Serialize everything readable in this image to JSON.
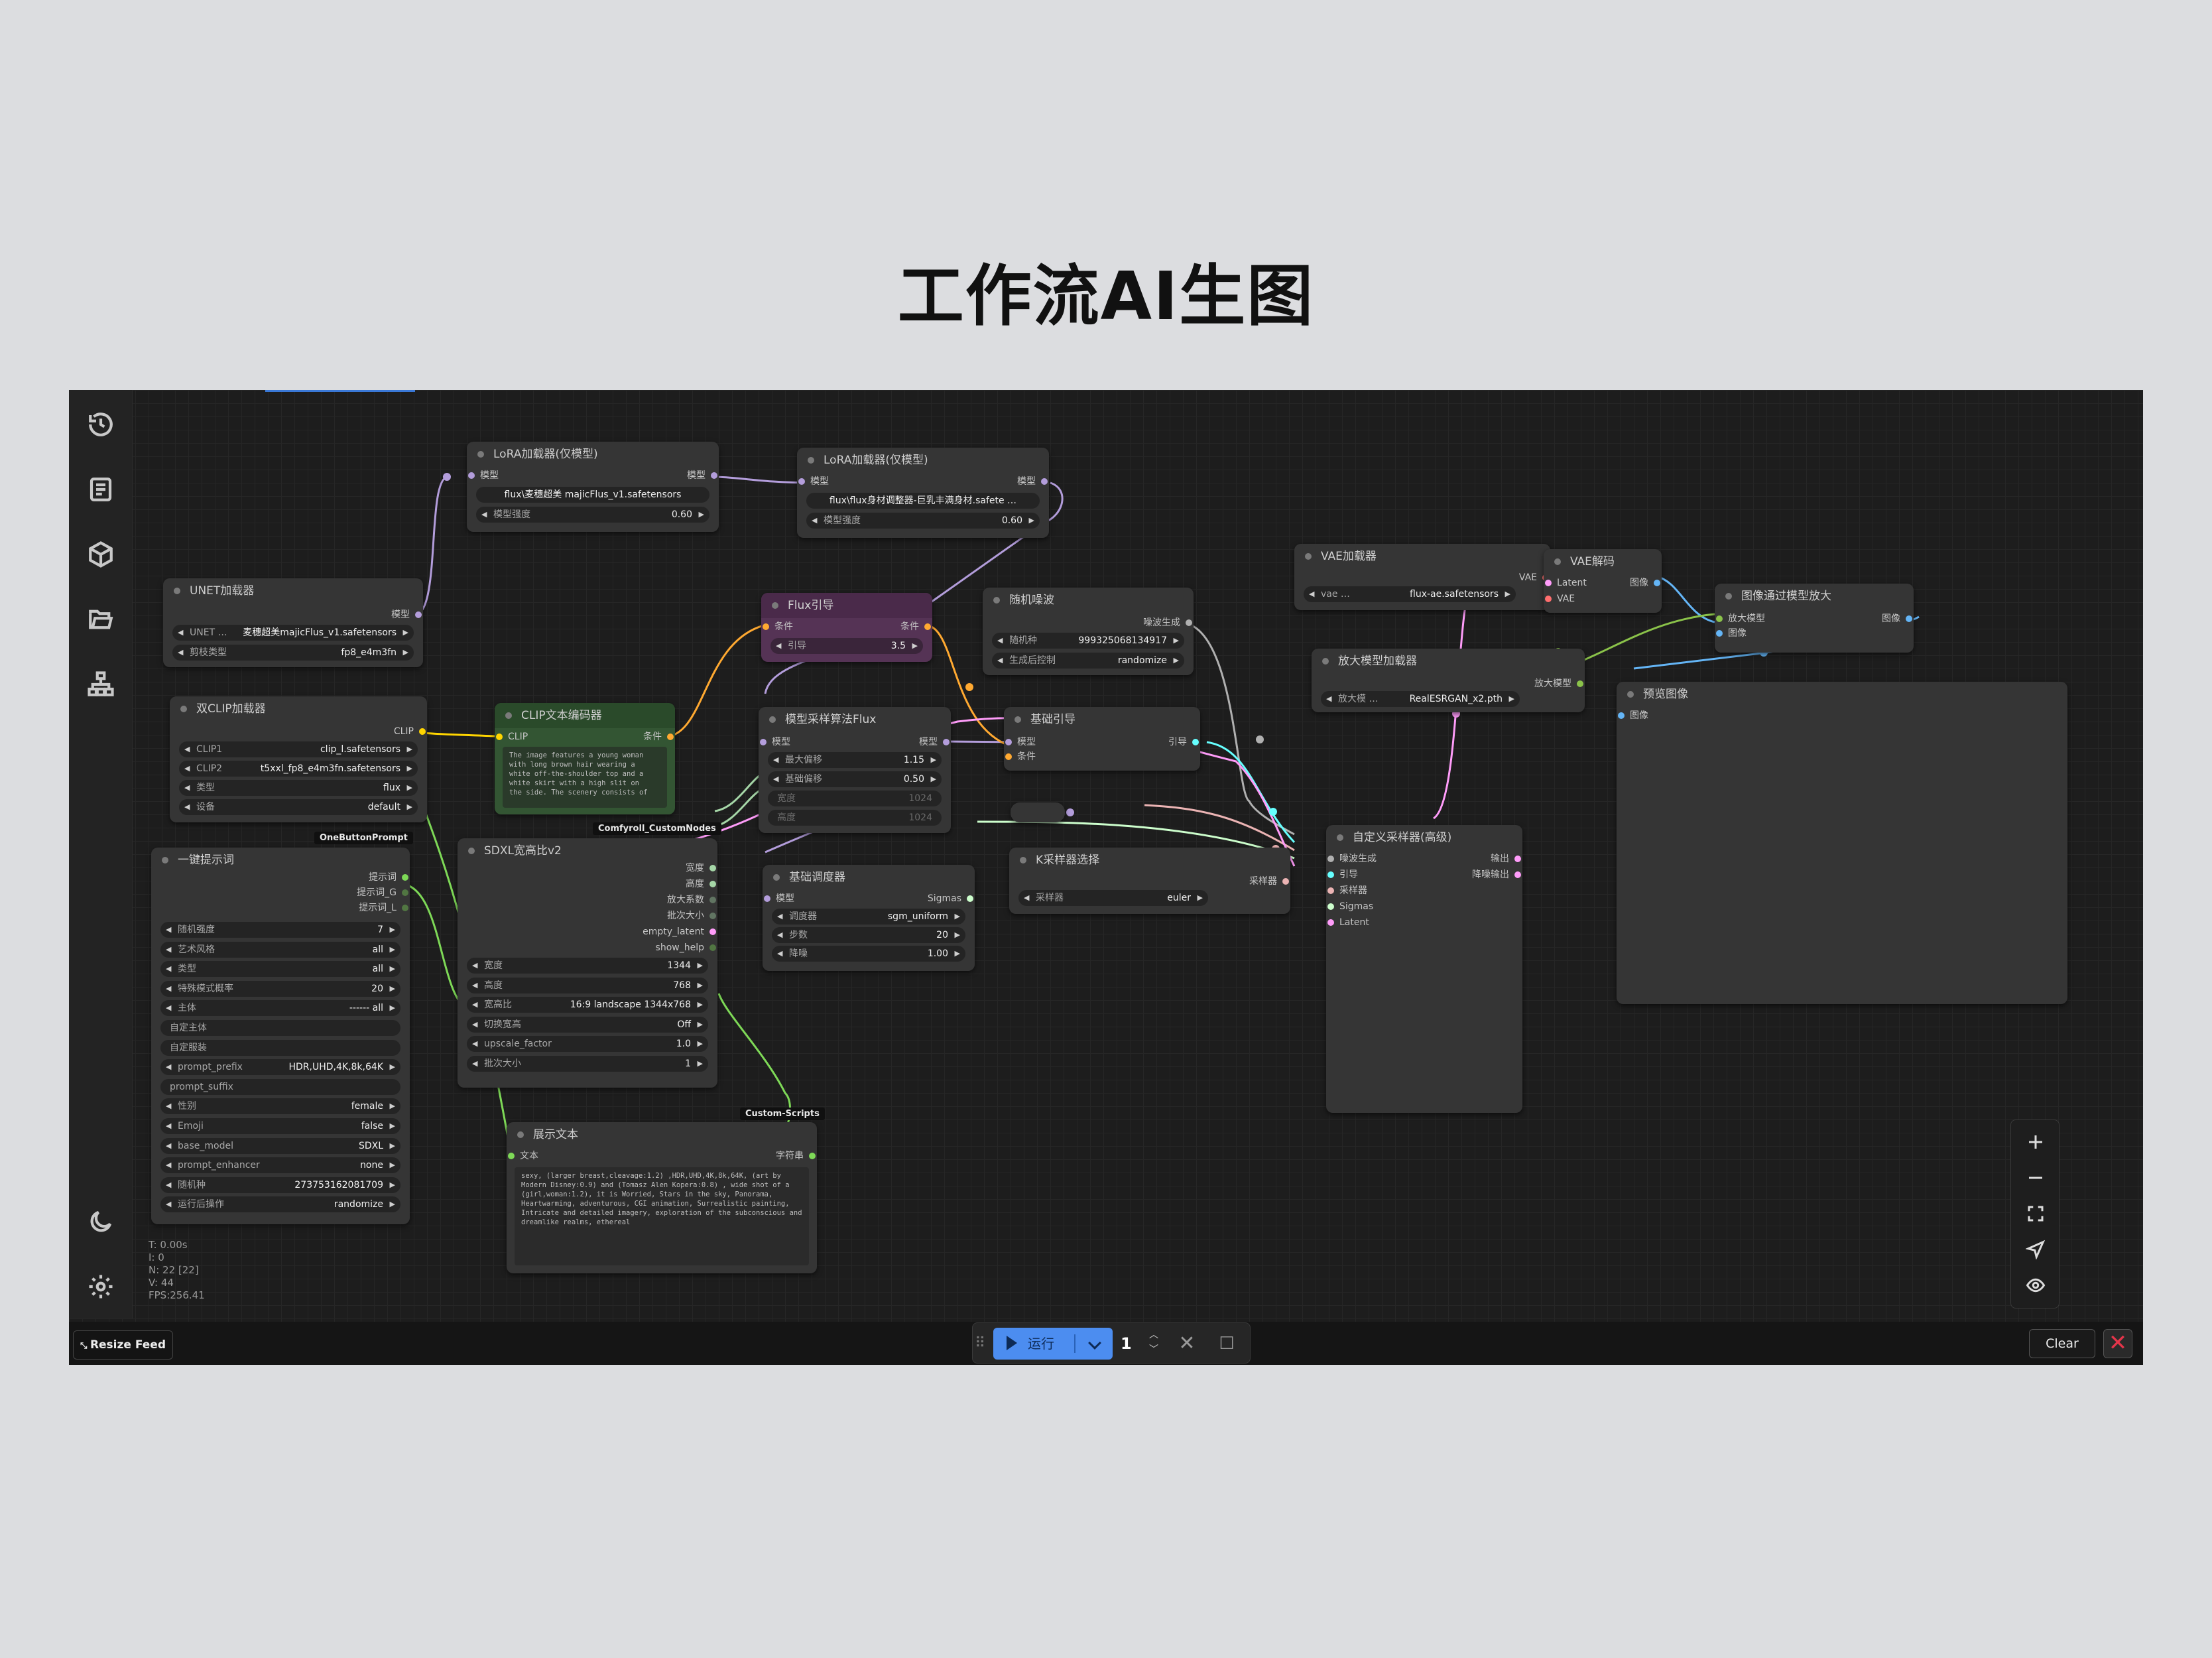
{
  "slide": {
    "title": "工作流AI生图"
  },
  "sidebar": {
    "items": [
      {
        "icon": "history-icon"
      },
      {
        "icon": "queue-list-icon"
      },
      {
        "icon": "model-cube-icon"
      },
      {
        "icon": "workflow-folder-icon"
      },
      {
        "icon": "node-library-icon"
      },
      {
        "icon": "theme-moon-icon"
      },
      {
        "icon": "settings-gear-icon"
      }
    ]
  },
  "nodes": {
    "lora1": {
      "title": "LoRA加载器(仅模型)",
      "in_model": "模型",
      "out_model": "模型",
      "w_name": "flux\\麦穗超美 majicFlus_v1.safetensors",
      "w_strength_label": "模型强度",
      "w_strength": "0.60"
    },
    "lora2": {
      "title": "LoRA加载器(仅模型)",
      "in_model": "模型",
      "out_model": "模型",
      "w_name": "flux\\flux身材调整器-巨乳丰满身材.safete …",
      "w_strength_label": "模型强度",
      "w_strength": "0.60"
    },
    "unet": {
      "title": "UNET加载器",
      "out_model": "模型",
      "w_unet_label": "UNET …",
      "w_unet": "麦穗超美majicFlus_v1.safetensors",
      "w_dtype_label": "剪枝类型",
      "w_dtype": "fp8_e4m3fn"
    },
    "dualclip": {
      "title": "双CLIP加载器",
      "out_clip": "CLIP",
      "w1_label": "CLIP1",
      "w1": "clip_l.safetensors",
      "w2_label": "CLIP2",
      "w2": "t5xxl_fp8_e4m3fn.safetensors",
      "w3_label": "类型",
      "w3": "flux",
      "w4_label": "设备",
      "w4": "default"
    },
    "clipencode": {
      "title": "CLIP文本编码器",
      "in_clip": "CLIP",
      "out_cond": "条件",
      "text": "The image features a young woman\nwith long brown hair wearing a\nwhite off-the-shoulder top and a\nwhite skirt with a high slit on\nthe side. The scenery consists of"
    },
    "fluxguide": {
      "title": "Flux引导",
      "in_cond": "条件",
      "out_cond": "条件",
      "w_guide_label": "引导",
      "w_guide": "3.5"
    },
    "noise": {
      "title": "随机噪波",
      "out_noise": "噪波生成",
      "w_seed_label": "随机种",
      "w_seed": "999325068134917",
      "w_ctrl_label": "生成后控制",
      "w_ctrl": "randomize"
    },
    "modelsampling": {
      "title": "模型采样算法Flux",
      "in_model": "模型",
      "out_model": "模型",
      "w1_label": "最大偏移",
      "w1": "1.15",
      "w2_label": "基础偏移",
      "w2": "0.50",
      "w3_label": "宽度",
      "w3": "1024",
      "w4_label": "高度",
      "w4": "1024"
    },
    "basicguider": {
      "title": "基础引导",
      "in_model": "模型",
      "in_cond": "条件",
      "out_guider": "引导"
    },
    "vaeloader": {
      "title": "VAE加载器",
      "out_vae": "VAE",
      "w_label": "vae …",
      "w": "flux-ae.safetensors"
    },
    "vaedecode": {
      "title": "VAE解码",
      "in_latent": "Latent",
      "in_vae": "VAE",
      "out_image": "图像"
    },
    "upscalewithmodel": {
      "title": "图像通过模型放大",
      "in_model": "放大模型",
      "in_image": "图像",
      "out_image": "图像"
    },
    "upscaleloader": {
      "title": "放大模型加载器",
      "out_model": "放大模型",
      "w_label": "放大模 …",
      "w": "RealESRGAN_x2.pth"
    },
    "preview": {
      "title": "预览图像",
      "in_image": "图像"
    },
    "oneprompt": {
      "badge": "OneButtonPrompt",
      "title": "一键提示词",
      "out1": "提示词",
      "out2": "提示词_G",
      "out3": "提示词_L",
      "widgets": [
        {
          "label": "随机强度",
          "value": "7"
        },
        {
          "label": "艺术风格",
          "value": "all"
        },
        {
          "label": "类型",
          "value": "all"
        },
        {
          "label": "特殊模式概率",
          "value": "20"
        },
        {
          "label": "主体",
          "value": "------ all"
        },
        {
          "label": "自定主体",
          "value": ""
        },
        {
          "label": "自定服装",
          "value": ""
        },
        {
          "label": "prompt_prefix",
          "value": "HDR,UHD,4K,8k,64K"
        },
        {
          "label": "prompt_suffix",
          "value": ""
        },
        {
          "label": "性别",
          "value": "female"
        },
        {
          "label": "Emoji",
          "value": "false"
        },
        {
          "label": "base_model",
          "value": "SDXL"
        },
        {
          "label": "prompt_enhancer",
          "value": "none"
        },
        {
          "label": "随机种",
          "value": "273753162081709"
        },
        {
          "label": "运行后操作",
          "value": "randomize"
        }
      ]
    },
    "sdxlratio": {
      "badge": "Comfyroll_CustomNodes",
      "title": "SDXL宽高比v2",
      "out1": "宽度",
      "out2": "高度",
      "out3": "放大系数",
      "out4": "批次大小",
      "out5": "empty_latent",
      "out6": "show_help",
      "widgets": [
        {
          "label": "宽度",
          "value": "1344"
        },
        {
          "label": "高度",
          "value": "768"
        },
        {
          "label": "宽高比",
          "value": "16:9 landscape 1344x768"
        },
        {
          "label": "切换宽高",
          "value": "Off"
        },
        {
          "label": "upscale_factor",
          "value": "1.0"
        },
        {
          "label": "批次大小",
          "value": "1"
        }
      ]
    },
    "basicscheduler": {
      "title": "基础调度器",
      "in_model": "模型",
      "out_sigmas": "Sigmas",
      "w1_label": "调度器",
      "w1": "sgm_uniform",
      "w2_label": "步数",
      "w2": "20",
      "w3_label": "降噪",
      "w3": "1.00"
    },
    "ksamplerselect": {
      "title": "K采样器选择",
      "out_sampler": "采样器",
      "w_label": "采样器",
      "w": "euler"
    },
    "customsampler": {
      "title": "自定义采样器(高级)",
      "in1": "噪波生成",
      "in2": "引导",
      "in3": "采样器",
      "in4": "Sigmas",
      "in5": "Latent",
      "out1": "输出",
      "out2": "降噪输出"
    },
    "showtext": {
      "badge": "Custom-Scripts",
      "title": "展示文本",
      "in_text": "文本",
      "out_text": "字符串",
      "text": "sexy, (larger breast,cleavage:1.2) ,HDR,UHD,4K,8k,64K, (art by Modern Disney:0.9) and (Tomasz Alen Kopera:0.8) , wide shot of a (girl,woman:1.2), it is Worried, Stars in the sky, Panorama, Heartwarming, adventurous, CGI animation, Surrealistic painting, Intricate and detailed imagery, exploration of the subconscious and dreamlike realms, ethereal"
    }
  },
  "stats": {
    "t": "T: 0.00s",
    "i": "I: 0",
    "n": "N: 22 [22]",
    "v": "V: 44",
    "fps": "FPS:256.41"
  },
  "bottombar": {
    "resize_feed": "Resize Feed",
    "run_label": "运行",
    "count": "1",
    "clear": "Clear"
  },
  "colors": {
    "model": "#b39ddb",
    "clip": "#ffd500",
    "conditioning": "#ffa931",
    "latent": "#ff9cf9",
    "vae": "#ff6e6e",
    "image": "#64b5f6",
    "noise": "#b0b0b0",
    "guider": "#66ffff",
    "sampler": "#ecb4b4",
    "sigmas": "#cdffcd",
    "upscale_model": "#8bc34a",
    "string": "#7ed957",
    "int": "#a5d6a7",
    "run_blue": "#4c8df0",
    "close_red": "#e5354a"
  }
}
